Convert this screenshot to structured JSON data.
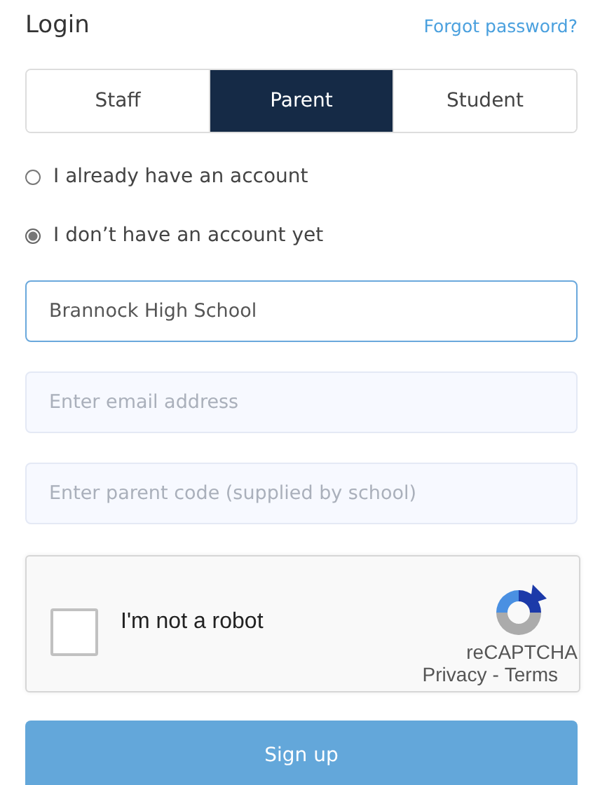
{
  "title": "Login",
  "forgot_link": "Forgot password?",
  "tabs": [
    {
      "label": "Staff",
      "selected": false
    },
    {
      "label": "Parent",
      "selected": true
    },
    {
      "label": "Student",
      "selected": false
    }
  ],
  "account_options": [
    {
      "label": "I already have an account",
      "selected": false
    },
    {
      "label": "I don’t have an account yet",
      "selected": true
    }
  ],
  "fields": [
    {
      "value": "Brannock High School",
      "focused": true
    },
    {
      "placeholder": "Enter email address",
      "focused": false
    },
    {
      "placeholder": "Enter parent code (supplied by school)",
      "focused": false
    }
  ],
  "captcha": {
    "label": "I'm not a robot",
    "checked": false,
    "brand": "reCAPTCHA",
    "privacy": "Privacy",
    "separator": "-",
    "terms": "Terms"
  },
  "submit": "Sign up"
}
